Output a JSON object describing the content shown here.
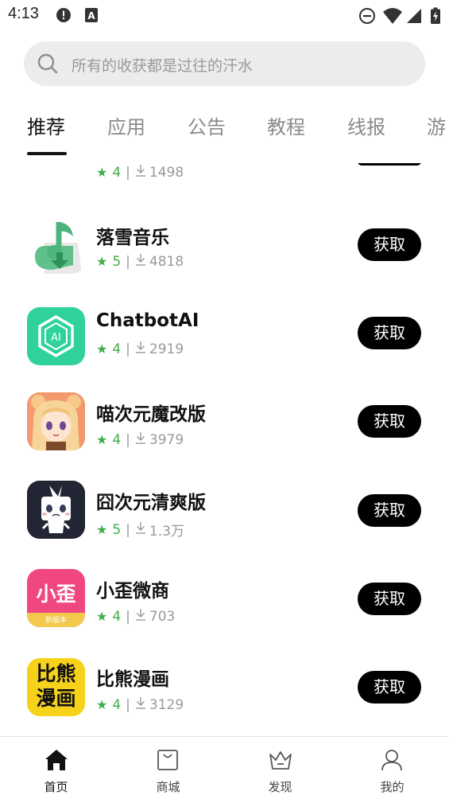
{
  "status_bar": {
    "time": "4:13",
    "icons": [
      "alert-icon",
      "text-a-icon",
      "do-not-disturb-icon",
      "wifi-icon",
      "signal-icon",
      "battery-charging-icon"
    ]
  },
  "search": {
    "placeholder": "所有的收获都是过往的汗水"
  },
  "tabs": [
    {
      "label": "推荐",
      "active": true
    },
    {
      "label": "应用"
    },
    {
      "label": "公告"
    },
    {
      "label": "教程"
    },
    {
      "label": "线报"
    },
    {
      "label": "游"
    }
  ],
  "apps": [
    {
      "name": "",
      "rating": "4",
      "downloads": "1498",
      "icon": "partial-red-app-icon",
      "button": ""
    },
    {
      "name": "落雪音乐",
      "rating": "5",
      "downloads": "4818",
      "icon": "music-note-download-icon",
      "button": "获取"
    },
    {
      "name": "ChatbotAI",
      "rating": "4",
      "downloads": "2919",
      "icon": "chatbot-ai-icon",
      "button": "获取"
    },
    {
      "name": "喵次元魔改版",
      "rating": "4",
      "downloads": "3979",
      "icon": "anime-girl-icon",
      "button": "获取"
    },
    {
      "name": "囧次元清爽版",
      "rating": "5",
      "downloads": "1.3万",
      "icon": "white-bunny-icon",
      "button": "获取"
    },
    {
      "name": "小歪微商",
      "rating": "4",
      "downloads": "703",
      "icon": "xiaowai-icon",
      "icon_text": "小歪",
      "icon_badge": "新版本",
      "button": "获取"
    },
    {
      "name": "比熊漫画",
      "rating": "4",
      "downloads": "3129",
      "icon": "bixiong-comic-icon",
      "icon_text": [
        "比熊",
        "漫画"
      ],
      "button": "获取"
    }
  ],
  "bottom_nav": [
    {
      "label": "首页",
      "icon": "home-icon",
      "active": true
    },
    {
      "label": "商城",
      "icon": "shop-bag-icon"
    },
    {
      "label": "发现",
      "icon": "crown-icon"
    },
    {
      "label": "我的",
      "icon": "person-icon"
    }
  ],
  "colors": {
    "accent_green": "#3fae4a",
    "button_black": "#000000",
    "search_bg": "#ececec"
  }
}
